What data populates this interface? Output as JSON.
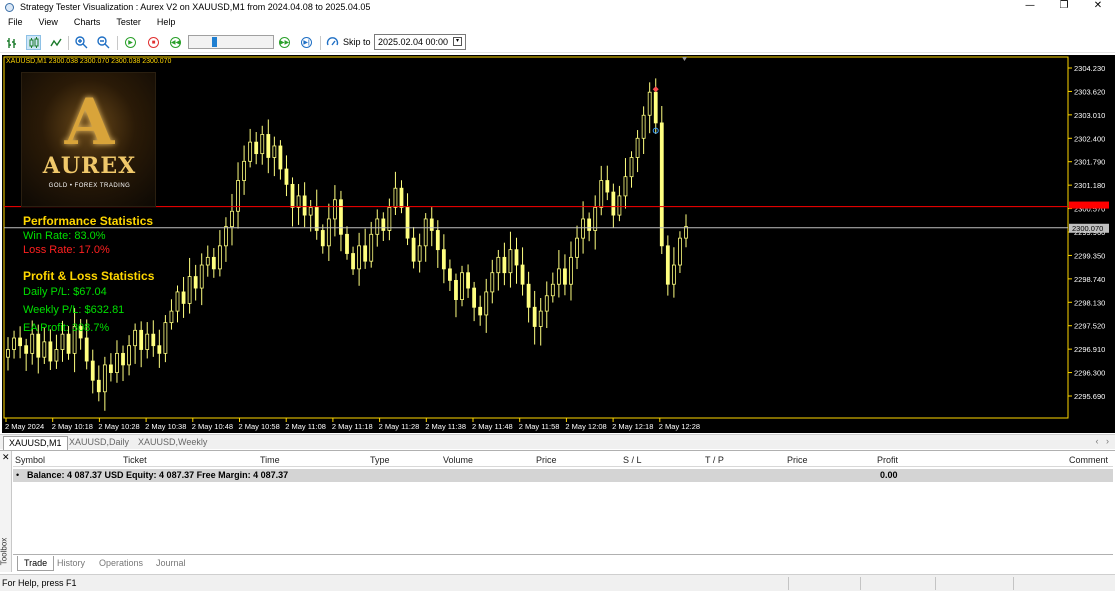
{
  "window": {
    "title": "Strategy Tester Visualization : Aurex V2 on XAUUSD,M1 from 2024.04.08 to 2025.04.05"
  },
  "menu": [
    "File",
    "View",
    "Charts",
    "Tester",
    "Help"
  ],
  "toolbar": {
    "skip_label": "Skip to",
    "skip_value": "2025.02.04 00:00",
    "icons": [
      "bar-chart-icon",
      "candle-chart-icon",
      "line-chart-icon",
      "zoom-in-icon",
      "zoom-out-icon",
      "play-icon",
      "stop-icon",
      "rewind-icon",
      "speed-slider",
      "fast-forward-icon",
      "skip-end-icon",
      "skip-to-icon"
    ]
  },
  "chart": {
    "info_line": "XAUUSD,M1  2300.038 2300.070 2300.038 2300.070",
    "logo": {
      "brand": "AUREX",
      "letter": "A",
      "tagline": "GOLD • FOREX TRADING"
    },
    "performance": {
      "title": "Performance Statistics",
      "win_rate": "Win Rate: 83.0%",
      "loss_rate": "Loss Rate: 17.0%"
    },
    "pnl": {
      "title": "Profit & Loss Statistics",
      "daily": "Daily P/L: $67.04",
      "weekly": "Weekly P/L: $632.81",
      "ea_profit": "EA Profit: 308.7%"
    },
    "price_labels": [
      "2304.230",
      "2303.620",
      "2303.010",
      "2302.400",
      "2301.790",
      "2301.180",
      "2300.570",
      "2299.960",
      "2299.350",
      "2298.740",
      "2298.130",
      "2297.520",
      "2296.910",
      "2296.300",
      "2295.690"
    ],
    "current_price_label": "2300.070",
    "time_labels": [
      "2 May 2024",
      "2 May 10:18",
      "2 May 10:28",
      "2 May 10:38",
      "2 May 10:48",
      "2 May 10:58",
      "2 May 11:08",
      "2 May 11:18",
      "2 May 11:28",
      "2 May 11:38",
      "2 May 11:48",
      "2 May 11:58",
      "2 May 12:08",
      "2 May 12:18",
      "2 May 12:28"
    ],
    "colors": {
      "background": "#000000",
      "candle": "#ffff80",
      "axis": "#ffd700",
      "current_line": "#c0c0c0",
      "red_line": "#ff0000"
    }
  },
  "chart_data": {
    "type": "candlestick",
    "symbol": "XAUUSD,M1",
    "ylim": [
      2295.3,
      2304.5
    ],
    "close_series": [
      2296.9,
      2297.2,
      2297.0,
      2296.8,
      2297.3,
      2296.7,
      2297.1,
      2296.6,
      2296.9,
      2297.3,
      2296.8,
      2297.5,
      2297.2,
      2296.6,
      2296.1,
      2295.8,
      2296.5,
      2296.3,
      2296.8,
      2296.5,
      2297.0,
      2297.4,
      2296.9,
      2297.3,
      2297.0,
      2296.8,
      2297.6,
      2297.9,
      2298.4,
      2298.1,
      2298.8,
      2298.5,
      2299.1,
      2299.3,
      2299.0,
      2299.6,
      2300.1,
      2300.5,
      2301.3,
      2301.8,
      2302.3,
      2302.0,
      2302.5,
      2301.9,
      2302.2,
      2301.6,
      2301.2,
      2300.6,
      2300.9,
      2300.4,
      2300.6,
      2300.0,
      2299.6,
      2300.3,
      2300.8,
      2299.9,
      2299.4,
      2299.0,
      2299.6,
      2299.2,
      2299.9,
      2300.3,
      2300.0,
      2300.6,
      2301.1,
      2300.6,
      2299.8,
      2299.2,
      2299.6,
      2300.3,
      2300.0,
      2299.5,
      2299.0,
      2298.7,
      2298.2,
      2298.9,
      2298.5,
      2298.0,
      2297.8,
      2298.4,
      2298.9,
      2299.3,
      2298.9,
      2299.5,
      2299.1,
      2298.6,
      2298.0,
      2297.5,
      2297.9,
      2298.3,
      2298.6,
      2299.0,
      2298.6,
      2299.3,
      2299.8,
      2300.3,
      2300.0,
      2300.6,
      2301.3,
      2301.0,
      2300.4,
      2300.9,
      2301.4,
      2301.9,
      2302.4,
      2303.0,
      2303.6,
      2302.8,
      2299.6,
      2298.6,
      2299.1,
      2299.8,
      2300.1
    ]
  },
  "tabs": {
    "chart_tabs": [
      "XAUUSD,M1",
      "XAUUSD,Daily",
      "XAUUSD,Weekly"
    ]
  },
  "toolbox": {
    "label": "Toolbox",
    "columns": [
      "Symbol",
      "Ticket",
      "Time",
      "Type",
      "Volume",
      "Price",
      "S / L",
      "T / P",
      "Price",
      "Profit",
      "Comment"
    ],
    "balance_text": "Balance: 4 087.37 USD  Equity: 4 087.37  Free Margin: 4 087.37",
    "profit": "0.00",
    "tabs": [
      "Trade",
      "History",
      "Operations",
      "Journal"
    ]
  },
  "status": {
    "help": "For Help, press F1"
  }
}
